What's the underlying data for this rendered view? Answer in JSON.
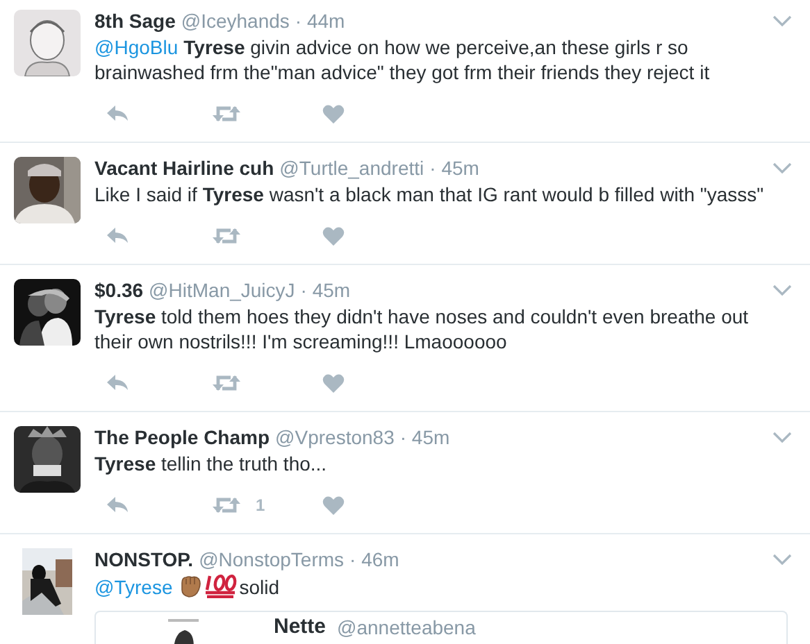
{
  "tweets": [
    {
      "name": "8th Sage",
      "handle": "@Iceyhands",
      "time": "· 44m",
      "parts": [
        {
          "kind": "mention",
          "text": "@HgoBlu"
        },
        {
          "kind": "text",
          "text": "**Tyrese** givin advice on how we perceive,an these girls r so brainwashed frm the\"man advice\" they got frm their friends they reject it"
        }
      ]
    },
    {
      "name": "Vacant Hairline cuh",
      "handle": "@Turtle_andretti",
      "time": "· 45m",
      "parts": [
        {
          "kind": "text",
          "text": "Like I said if **Tyrese** wasn't a black man that IG rant would b filled with \"yasss\""
        }
      ]
    },
    {
      "name": "$0.36",
      "handle": "@HitMan_JuicyJ",
      "time": "· 45m",
      "parts": [
        {
          "kind": "text",
          "text": "**Tyrese** told them hoes they didn't have noses and couldn't even breathe out their own nostrils!!! I'm screaming!!! Lmaoooooo"
        }
      ]
    },
    {
      "name": "The People Champ",
      "handle": "@Vpreston83",
      "time": "· 45m",
      "parts": [
        {
          "kind": "text",
          "text": "**Tyrese** tellin the truth tho..."
        }
      ],
      "retweets": "1"
    },
    {
      "name": "NONSTOP.",
      "handle": "@NonstopTerms",
      "time": "· 46m",
      "parts": [
        {
          "kind": "mention",
          "text": "@Tyrese"
        },
        {
          "kind": "fist"
        },
        {
          "kind": "hundred"
        },
        {
          "kind": "text",
          "text": "solid"
        }
      ],
      "quote": {
        "name": "Nette",
        "handle": "@annetteabena"
      }
    }
  ]
}
